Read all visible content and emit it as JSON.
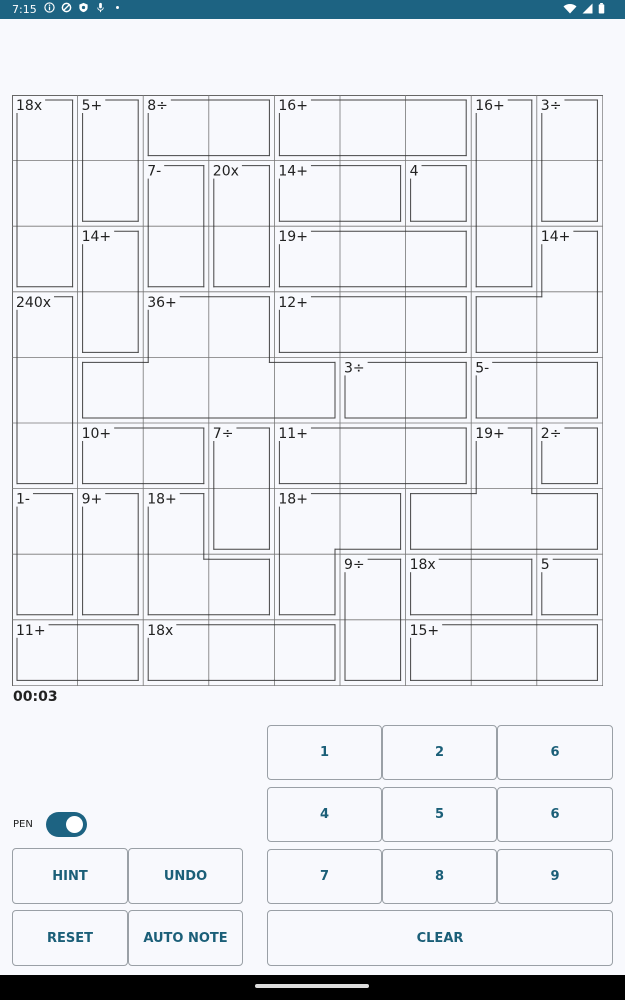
{
  "status_bar": {
    "time": "7:15",
    "left_icons": [
      "info-icon",
      "data-saver-icon",
      "shield-icon",
      "mic-icon",
      "dot-icon"
    ],
    "right_icons": [
      "wifi-icon",
      "signal-icon",
      "battery-icon"
    ]
  },
  "puzzle": {
    "size": 9,
    "cages": [
      {
        "label": "18x",
        "cells": [
          [
            0,
            0
          ],
          [
            1,
            0
          ],
          [
            2,
            0
          ]
        ]
      },
      {
        "label": "5+",
        "cells": [
          [
            0,
            1
          ],
          [
            1,
            1
          ]
        ]
      },
      {
        "label": "8÷",
        "cells": [
          [
            0,
            2
          ],
          [
            0,
            3
          ]
        ]
      },
      {
        "label": "16+",
        "cells": [
          [
            0,
            4
          ],
          [
            0,
            5
          ],
          [
            0,
            6
          ]
        ]
      },
      {
        "label": "16+",
        "cells": [
          [
            0,
            7
          ],
          [
            1,
            7
          ],
          [
            2,
            7
          ]
        ]
      },
      {
        "label": "3÷",
        "cells": [
          [
            0,
            8
          ],
          [
            1,
            8
          ]
        ]
      },
      {
        "label": "7-",
        "cells": [
          [
            1,
            2
          ],
          [
            2,
            2
          ]
        ]
      },
      {
        "label": "20x",
        "cells": [
          [
            1,
            3
          ],
          [
            2,
            3
          ]
        ]
      },
      {
        "label": "14+",
        "cells": [
          [
            1,
            4
          ],
          [
            1,
            5
          ]
        ]
      },
      {
        "label": "4",
        "cells": [
          [
            1,
            6
          ]
        ]
      },
      {
        "label": "14+",
        "cells": [
          [
            2,
            1
          ],
          [
            3,
            1
          ]
        ]
      },
      {
        "label": "19+",
        "cells": [
          [
            2,
            4
          ],
          [
            2,
            5
          ],
          [
            2,
            6
          ]
        ]
      },
      {
        "label": "14+",
        "cells": [
          [
            2,
            8
          ],
          [
            3,
            7
          ],
          [
            3,
            8
          ]
        ]
      },
      {
        "label": "240x",
        "cells": [
          [
            3,
            0
          ],
          [
            4,
            0
          ],
          [
            5,
            0
          ]
        ]
      },
      {
        "label": "36+",
        "cells": [
          [
            3,
            2
          ],
          [
            3,
            3
          ],
          [
            4,
            1
          ],
          [
            4,
            2
          ],
          [
            4,
            3
          ],
          [
            4,
            4
          ]
        ]
      },
      {
        "label": "12+",
        "cells": [
          [
            3,
            4
          ],
          [
            3,
            5
          ],
          [
            3,
            6
          ]
        ]
      },
      {
        "label": "3÷",
        "cells": [
          [
            4,
            5
          ],
          [
            4,
            6
          ]
        ]
      },
      {
        "label": "5-",
        "cells": [
          [
            4,
            7
          ],
          [
            4,
            8
          ]
        ]
      },
      {
        "label": "10+",
        "cells": [
          [
            5,
            1
          ],
          [
            5,
            2
          ]
        ]
      },
      {
        "label": "7÷",
        "cells": [
          [
            5,
            3
          ],
          [
            6,
            3
          ]
        ]
      },
      {
        "label": "11+",
        "cells": [
          [
            5,
            4
          ],
          [
            5,
            5
          ],
          [
            5,
            6
          ]
        ]
      },
      {
        "label": "19+",
        "cells": [
          [
            5,
            7
          ],
          [
            6,
            6
          ],
          [
            6,
            7
          ],
          [
            6,
            8
          ]
        ]
      },
      {
        "label": "2÷",
        "cells": [
          [
            5,
            8
          ]
        ]
      },
      {
        "label": "1-",
        "cells": [
          [
            6,
            0
          ],
          [
            7,
            0
          ]
        ]
      },
      {
        "label": "9+",
        "cells": [
          [
            6,
            1
          ],
          [
            7,
            1
          ]
        ]
      },
      {
        "label": "18+",
        "cells": [
          [
            6,
            2
          ],
          [
            7,
            2
          ],
          [
            7,
            3
          ]
        ]
      },
      {
        "label": "18+",
        "cells": [
          [
            6,
            4
          ],
          [
            6,
            5
          ],
          [
            7,
            4
          ]
        ]
      },
      {
        "label": "9÷",
        "cells": [
          [
            7,
            5
          ],
          [
            8,
            5
          ]
        ]
      },
      {
        "label": "18x",
        "cells": [
          [
            7,
            6
          ],
          [
            7,
            7
          ]
        ]
      },
      {
        "label": "5",
        "cells": [
          [
            7,
            8
          ]
        ]
      },
      {
        "label": "11+",
        "cells": [
          [
            8,
            0
          ],
          [
            8,
            1
          ]
        ]
      },
      {
        "label": "18x",
        "cells": [
          [
            8,
            2
          ],
          [
            8,
            3
          ],
          [
            8,
            4
          ]
        ]
      },
      {
        "label": "15+",
        "cells": [
          [
            8,
            6
          ],
          [
            8,
            7
          ],
          [
            8,
            8
          ]
        ]
      }
    ]
  },
  "timer": "00:03",
  "pen": {
    "label": "PEN",
    "on": true
  },
  "controls": {
    "hint": "HINT",
    "undo": "UNDO",
    "reset": "RESET",
    "auto_note": "AUTO NOTE",
    "clear": "CLEAR"
  },
  "keypad": [
    "1",
    "2",
    "6",
    "4",
    "5",
    "6",
    "7",
    "8",
    "9"
  ]
}
